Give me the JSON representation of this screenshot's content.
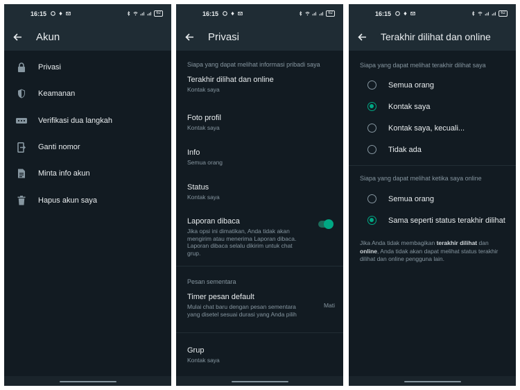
{
  "status": {
    "time": "16:15",
    "battery": "62",
    "network": "5G"
  },
  "screen1": {
    "title": "Akun",
    "items": [
      {
        "label": "Privasi",
        "icon": "lock-icon"
      },
      {
        "label": "Keamanan",
        "icon": "shield-icon"
      },
      {
        "label": "Verifikasi dua langkah",
        "icon": "dots-icon"
      },
      {
        "label": "Ganti nomor",
        "icon": "change-number-icon"
      },
      {
        "label": "Minta info akun",
        "icon": "document-icon"
      },
      {
        "label": "Hapus akun saya",
        "icon": "trash-icon"
      }
    ]
  },
  "screen2": {
    "title": "Privasi",
    "section1": "Siapa yang dapat melihat informasi pribadi saya",
    "items": [
      {
        "title": "Terakhir dilihat dan online",
        "sub": "Kontak saya"
      },
      {
        "title": "Foto profil",
        "sub": "Kontak saya"
      },
      {
        "title": "Info",
        "sub": "Semua orang"
      },
      {
        "title": "Status",
        "sub": "Kontak saya"
      }
    ],
    "read_receipts": {
      "title": "Laporan dibaca",
      "sub": "Jika opsi ini dimatikan, Anda tidak akan mengirim atau menerima Laporan dibaca. Laporan dibaca selalu dikirim untuk chat grup.",
      "enabled": true
    },
    "section2": "Pesan sementara",
    "timer": {
      "title": "Timer pesan default",
      "sub": "Mulai chat baru dengan pesan sementara yang disetel sesuai durasi yang Anda pilih",
      "value": "Mati"
    },
    "group": {
      "title": "Grup",
      "sub": "Kontak saya"
    }
  },
  "screen3": {
    "title": "Terakhir dilihat dan online",
    "section1": "Siapa yang dapat melihat terakhir dilihat saya",
    "options1": [
      {
        "label": "Semua orang",
        "selected": false
      },
      {
        "label": "Kontak saya",
        "selected": true
      },
      {
        "label": "Kontak saya, kecuali...",
        "selected": false
      },
      {
        "label": "Tidak ada",
        "selected": false
      }
    ],
    "section2": "Siapa yang dapat melihat ketika saya online",
    "options2": [
      {
        "label": "Semua orang",
        "selected": false
      },
      {
        "label": "Sama seperti status terakhir dilihat",
        "selected": true
      }
    ],
    "note": {
      "part1": "Jika Anda tidak membagikan ",
      "bold1": "terakhir dilihat",
      "part2": " dan ",
      "bold2": "online",
      "part3": ", Anda tidak akan dapat melihat status terakhir dilihat dan online pengguna lain."
    }
  },
  "colors": {
    "background": "#121b22",
    "bar": "#1f2c34",
    "accent": "#00a884",
    "text": "#e9edef",
    "secondary": "#8696a0"
  }
}
